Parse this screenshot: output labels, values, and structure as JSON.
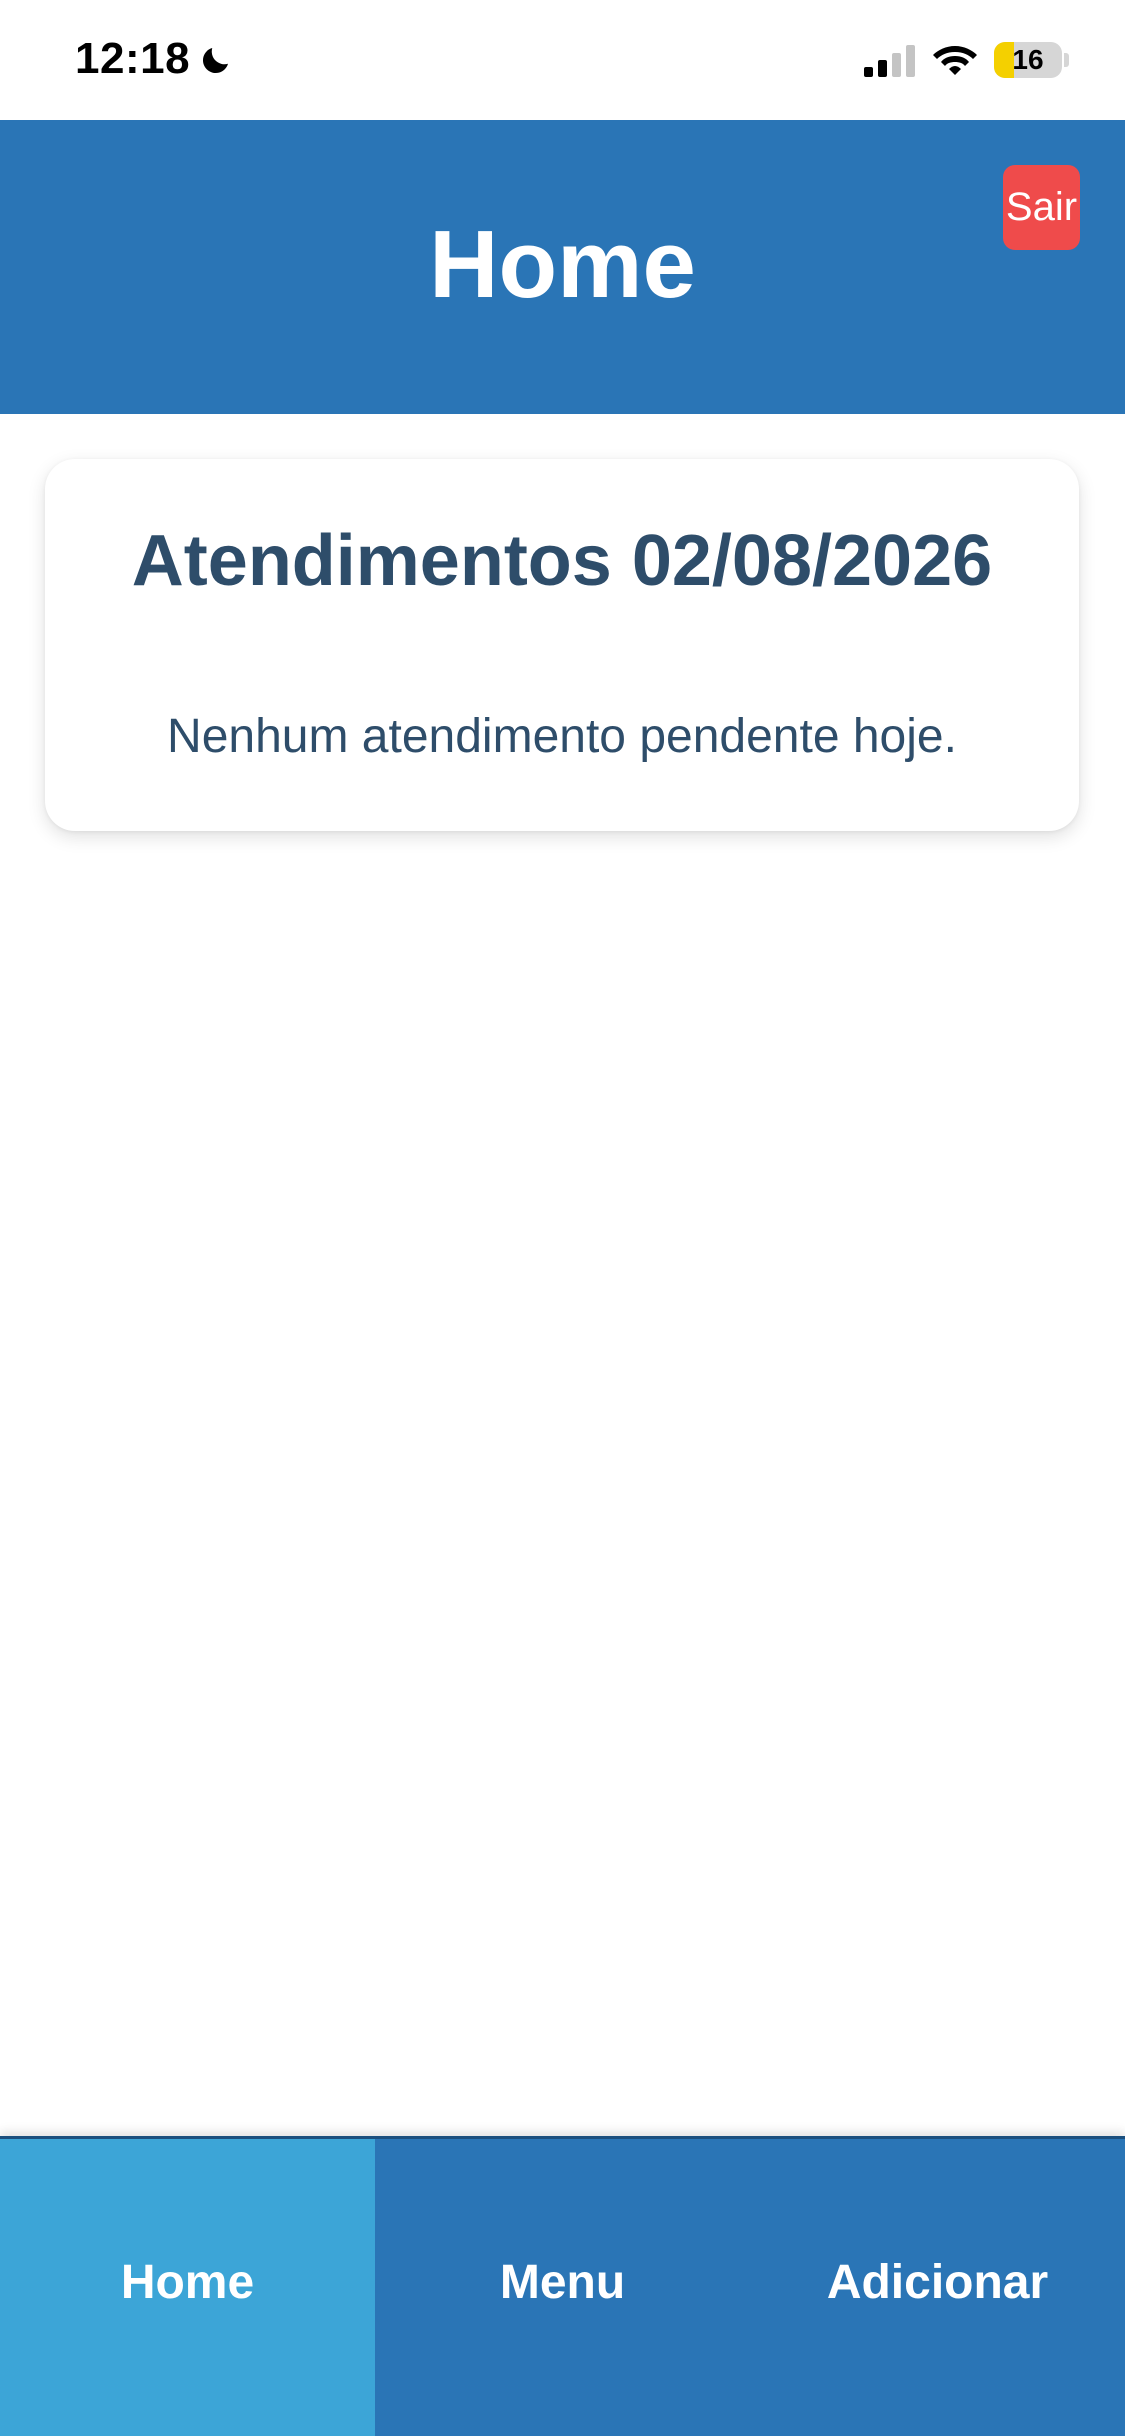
{
  "status_bar": {
    "time": "12:18",
    "battery_level": "16",
    "icons": [
      "moon-icon",
      "signal-icon",
      "wifi-icon",
      "battery-icon"
    ]
  },
  "header": {
    "title": "Home",
    "logout_label": "Sair"
  },
  "card": {
    "title": "Atendimentos 02/08/2026",
    "empty_message": "Nenhum atendimento pendente hoje."
  },
  "tabs": [
    {
      "label": "Home",
      "active": true
    },
    {
      "label": "Menu",
      "active": false
    },
    {
      "label": "Adicionar",
      "active": false
    }
  ],
  "colors": {
    "primary": "#2a75b6",
    "active_tab": "#3ca5d7",
    "logout": "#ef4b4b",
    "card_text": "#2e4d6a",
    "battery": "#f4d000"
  }
}
